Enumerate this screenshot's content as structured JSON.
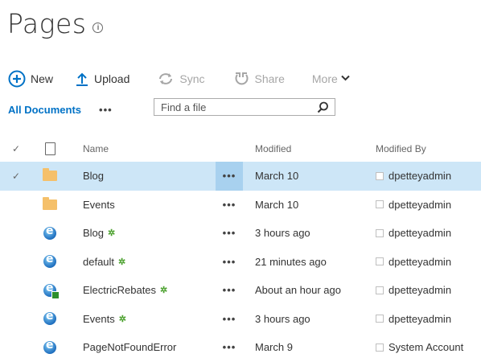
{
  "page": {
    "title": "Pages"
  },
  "toolbar": {
    "new_label": "New",
    "upload_label": "Upload",
    "sync_label": "Sync",
    "share_label": "Share",
    "more_label": "More"
  },
  "view": {
    "label": "All Documents",
    "ellipsis": "•••"
  },
  "search": {
    "placeholder": "Find a file"
  },
  "columns": {
    "name": "Name",
    "modified": "Modified",
    "modified_by": "Modified By"
  },
  "rows": [
    {
      "name": "Blog",
      "modified": "March 10",
      "modified_by": "dpetteyadmin",
      "icon": "folder-icon",
      "new": false,
      "selected": true
    },
    {
      "name": "Events",
      "modified": "March 10",
      "modified_by": "dpetteyadmin",
      "icon": "folder-icon",
      "new": false,
      "selected": false
    },
    {
      "name": "Blog",
      "modified": "3 hours ago",
      "modified_by": "dpetteyadmin",
      "icon": "web-page-icon",
      "new": true,
      "selected": false
    },
    {
      "name": "default",
      "modified": "21 minutes ago",
      "modified_by": "dpetteyadmin",
      "icon": "web-page-icon",
      "new": true,
      "selected": false
    },
    {
      "name": "ElectricRebates",
      "modified": "About an hour ago",
      "modified_by": "dpetteyadmin",
      "icon": "web-page-checked-out-icon",
      "new": true,
      "selected": false
    },
    {
      "name": "Events",
      "modified": "3 hours ago",
      "modified_by": "dpetteyadmin",
      "icon": "web-page-icon",
      "new": true,
      "selected": false
    },
    {
      "name": "PageNotFoundError",
      "modified": "March 9",
      "modified_by": "System Account",
      "icon": "web-page-icon",
      "new": false,
      "selected": false
    }
  ],
  "row_ellipsis": "•••",
  "colors": {
    "accent": "#0072c6",
    "selected_row": "#cde6f7",
    "new_star": "#4aa02c"
  }
}
